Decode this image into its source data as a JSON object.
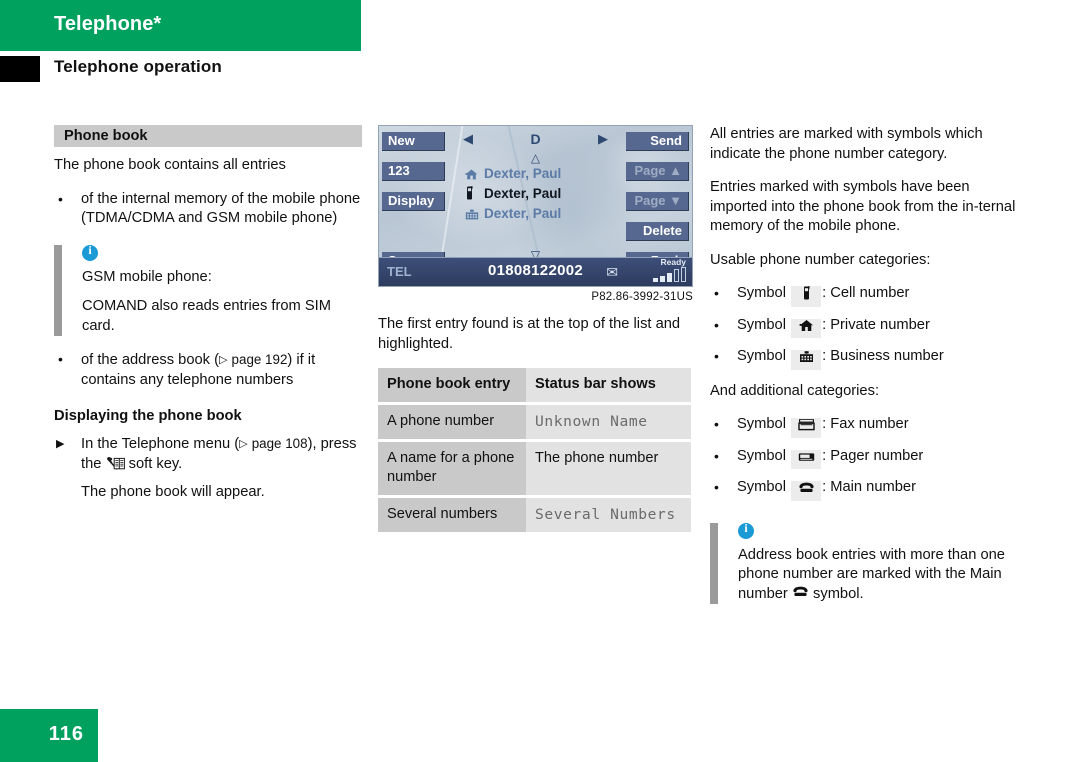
{
  "header": {
    "title": "Telephone*",
    "subtitle": "Telephone operation"
  },
  "footer": {
    "page_number": "116"
  },
  "colors": {
    "brand_green": "#00a05e",
    "heading_bar_gray": "#c9c9c9",
    "note_bar_gray": "#9a9a9a",
    "info_blue": "#1b9ad6",
    "screen_button": "#56688f"
  },
  "left_column": {
    "section_heading": "Phone book",
    "intro": "The phone book contains all entries",
    "bullets": [
      "of the internal memory of the mobile phone (TDMA/CDMA and GSM mobile phone)"
    ],
    "note": {
      "icon": "info-icon",
      "lines": [
        "GSM mobile phone:",
        "COMAND also reads entries from SIM card."
      ]
    },
    "bullets2_prefix": "of the address book (",
    "bullets2_ref": "page 192",
    "bullets2_suffix": ") if it contains any telephone numbers",
    "subheading": "Displaying the phone book",
    "step_prefix": "In the Telephone menu (",
    "step_ref": "page 108",
    "step_suffix": "), press the",
    "step_icon": "phonebook-softkey-icon",
    "step_tail": "soft key.",
    "step_result": "The phone book will appear."
  },
  "comand_screen": {
    "left_buttons": [
      {
        "label": "New",
        "state": "enabled"
      },
      {
        "label": "123",
        "state": "enabled"
      },
      {
        "label": "Display",
        "state": "enabled"
      },
      {
        "label": "Save",
        "state": "enabled"
      }
    ],
    "right_buttons": [
      {
        "label": "Send",
        "state": "enabled"
      },
      {
        "label": "Page ▲",
        "state": "disabled"
      },
      {
        "label": "Page ▼",
        "state": "disabled"
      },
      {
        "label": "Delete",
        "state": "enabled"
      },
      {
        "label": "Back",
        "state": "enabled"
      }
    ],
    "nav_left_icon": "triangle-left-icon",
    "nav_right_icon": "triangle-right-icon",
    "letter": "D",
    "scroll_up_icon": "triangle-up-outline-icon",
    "scroll_down_icon": "triangle-down-outline-icon",
    "entries": [
      {
        "icon": "house-icon",
        "name": "Dexter, Paul",
        "selected": false
      },
      {
        "icon": "cellphone-icon",
        "name": "Dexter, Paul",
        "selected": true
      },
      {
        "icon": "building-icon",
        "name": "Dexter, Paul",
        "selected": false
      }
    ],
    "status_bar": {
      "mode": "TEL",
      "number": "01808122002",
      "envelope_icon": "envelope-icon",
      "ready_label": "Ready",
      "signal_icon": "signal-bars-icon"
    },
    "caption": "P82.86-3992-31US"
  },
  "middle_column": {
    "paragraph": "The first entry found is at the top of the list and highlighted.",
    "table": {
      "headers": [
        "Phone book entry",
        "Status bar shows"
      ],
      "rows": [
        {
          "entry": "A phone number",
          "status": "Unknown Name",
          "status_style": "mono"
        },
        {
          "entry": "A name for a phone number",
          "status": "The phone number",
          "status_style": "normal"
        },
        {
          "entry": "Several numbers",
          "status": "Several Numbers",
          "status_style": "mono"
        }
      ]
    }
  },
  "right_column": {
    "paragraph1": "All entries are marked with symbols which indicate the phone number category.",
    "paragraph2": "Entries marked with symbols have been imported into the phone book from the in-ternal memory of the mobile phone.",
    "paragraph3": "Usable phone number categories:",
    "categories": [
      {
        "prefix": "Symbol",
        "icon": "cellphone-icon",
        "suffix": ": Cell number"
      },
      {
        "prefix": "Symbol",
        "icon": "house-icon",
        "suffix": ": Private number"
      },
      {
        "prefix": "Symbol",
        "icon": "building-icon",
        "suffix": ": Business number"
      }
    ],
    "paragraph4": "And additional categories:",
    "categories2": [
      {
        "prefix": "Symbol",
        "icon": "fax-icon",
        "suffix": ": Fax number"
      },
      {
        "prefix": "Symbol",
        "icon": "pager-icon",
        "suffix": ": Pager number"
      },
      {
        "prefix": "Symbol",
        "icon": "telephone-icon",
        "suffix": ": Main number"
      }
    ],
    "note": {
      "icon": "info-icon",
      "text_before": "Address book entries with more than one phone number are marked with the Main number",
      "icon2": "telephone-icon",
      "text_after": "symbol."
    }
  }
}
